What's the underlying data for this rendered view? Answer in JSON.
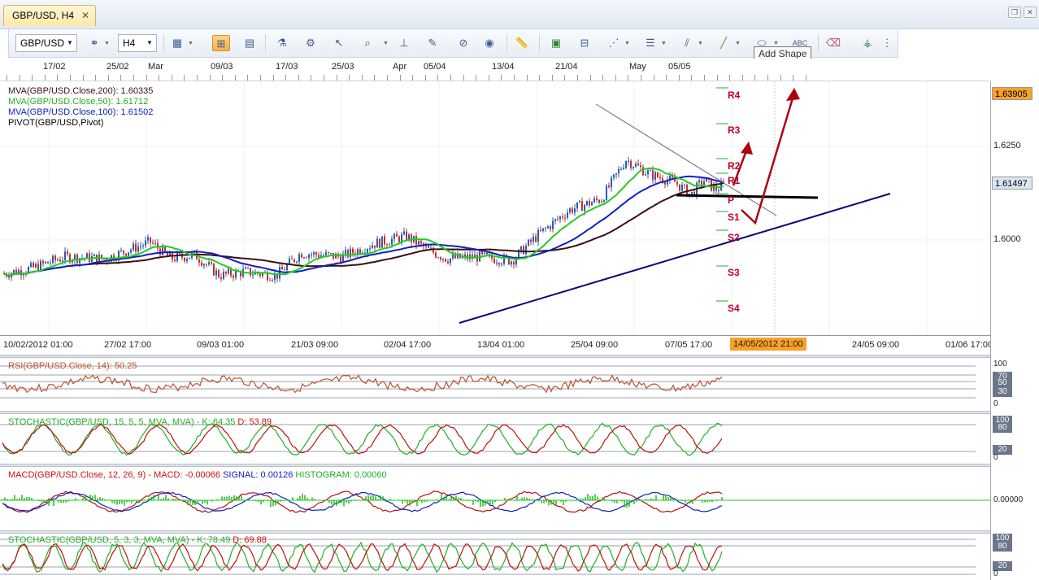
{
  "window": {
    "tab_title": "GBP/USD, H4",
    "close_glyph": "✕"
  },
  "toolbar": {
    "symbol_value": "GBP/USD",
    "timeframe_value": "H4",
    "tooltip": "Add Shape",
    "icons": [
      "chart-type-icon",
      "crosshair-icon",
      "data-window-icon",
      "indicator-icon",
      "strategy-icon",
      "cursor-icon",
      "zoom-icon",
      "level-line-icon",
      "trendline-edit-icon",
      "compass-icon",
      "globe-icon",
      "ruler-icon",
      "image-icon",
      "template-icon",
      "fibonacci-icon",
      "horizontal-lines-icon",
      "pitchfork-icon",
      "pen-icon",
      "add-shape-icon",
      "text-icon",
      "eraser-icon",
      "hierarchy-icon",
      "more-icon"
    ]
  },
  "top_axis_labels": [
    "17/02",
    "25/02",
    "Mar",
    "09/03",
    "17/03",
    "25/03",
    "Apr",
    "05/04",
    "13/04",
    "21/04",
    "May",
    "05/05"
  ],
  "bottom_axis_labels": [
    "10/02/2012 01:00",
    "27/02 17:00",
    "09/03 01:00",
    "21/03 09:00",
    "02/04 17:00",
    "13/04 01:00",
    "25/04 09:00",
    "07/05 17:00",
    "24/05 09:00",
    "01/06 17:00"
  ],
  "date_badge": "14/05/2012 21:00",
  "price_panel": {
    "legend": [
      {
        "text": "MVA(GBP/USD.Close,200): 1.60335",
        "color": "#3a1010"
      },
      {
        "text": "MVA(GBP/USD.Close,50): 1.61712",
        "color": "#22b022"
      },
      {
        "text": "MVA(GBP/USD.Close,100): 1.61502",
        "color": "#1020c0"
      },
      {
        "text": "PIVOT(GBP/USD,Pivot)",
        "color": "#000000"
      }
    ],
    "y_labels": [
      "1.6250",
      "1.6000"
    ],
    "price_boxes": [
      {
        "value": "1.63905",
        "bg": "#f7a12c"
      },
      {
        "value": "1.61497",
        "bg": "#d9e7f5"
      }
    ],
    "pivot_labels": [
      "R4",
      "R3",
      "R2",
      "R1",
      "P",
      "S1",
      "S2",
      "S3",
      "S4"
    ]
  },
  "rsi": {
    "legend": "RSI(GBP/USD.Close, 14): 50.25",
    "color": "#c0502a",
    "scale": [
      "100",
      "70",
      "50",
      "30",
      "0"
    ]
  },
  "stoch1": {
    "legend_parts": [
      {
        "text": "STOCHASTIC(GBP/USD, 15, 5, 5, MVA, MVA) -  K: 64.35",
        "color": "#22b022"
      },
      {
        "text": "  D: 53.89",
        "color": "#d01010"
      }
    ],
    "scale": [
      "100",
      "80",
      "20",
      "0"
    ]
  },
  "macd": {
    "legend_parts": [
      {
        "text": "MACD(GBP/USD.Close, 12, 26, 9) -  MACD: -0.00066",
        "color": "#d01010"
      },
      {
        "text": "  SIGNAL: 0.00126",
        "color": "#1020c0"
      },
      {
        "text": "  HISTOGRAM: 0.00060",
        "color": "#22b022"
      }
    ],
    "scale": [
      "0.00000"
    ]
  },
  "stoch2": {
    "legend_parts": [
      {
        "text": "STOCHASTIC(GBP/USD, 5, 3, 3, MVA, MVA) -  K: 78.49",
        "color": "#22b022"
      },
      {
        "text": "  D: 69.88",
        "color": "#d01010"
      }
    ],
    "scale": [
      "100",
      "80",
      "20",
      "0"
    ]
  }
}
